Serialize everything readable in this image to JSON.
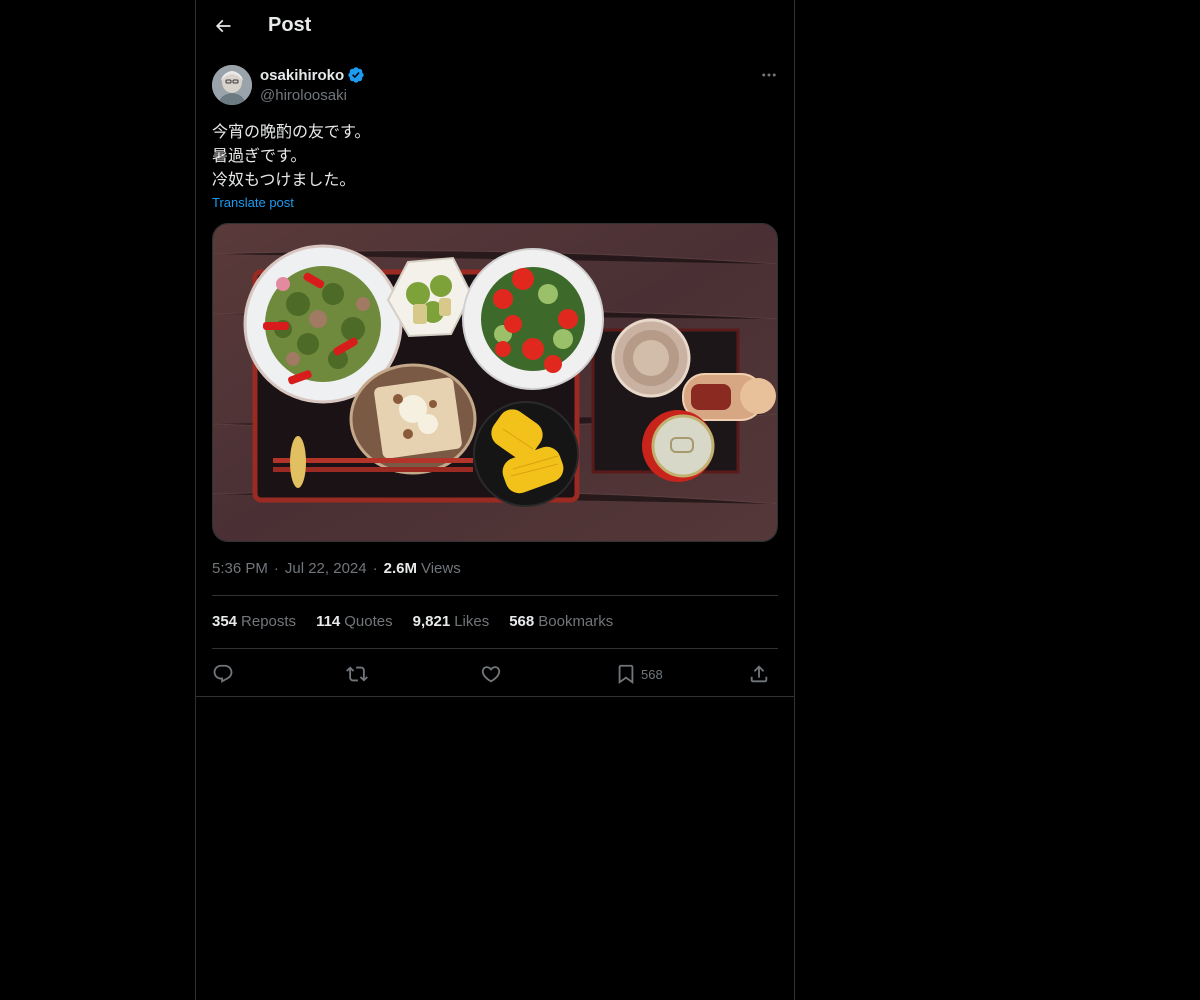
{
  "header": {
    "title": "Post",
    "back_icon": "arrow-left-icon"
  },
  "author": {
    "display_name": "osakihiroko",
    "handle": "@hiroloosaki",
    "verified": true,
    "verified_color": "#1d9bf0"
  },
  "post": {
    "lines": [
      "今宵の晩酌の友です。",
      "暑過ぎです。",
      "冷奴もつけました。"
    ],
    "translate_label": "Translate post"
  },
  "meta": {
    "time": "5:36 PM",
    "date": "Jul 22, 2024",
    "views_count": "2.6M",
    "views_label": "Views"
  },
  "stats": [
    {
      "count": "354",
      "label": "Reposts"
    },
    {
      "count": "114",
      "label": "Quotes"
    },
    {
      "count": "9,821",
      "label": "Likes"
    },
    {
      "count": "568",
      "label": "Bookmarks"
    }
  ],
  "actions": {
    "reply_icon": "reply-icon",
    "repost_icon": "repost-icon",
    "like_icon": "heart-icon",
    "bookmark_icon": "bookmark-icon",
    "bookmark_count": "568",
    "share_icon": "share-icon"
  },
  "colors": {
    "background": "#000000",
    "text": "#e7e9ea",
    "muted": "#71767b",
    "accent": "#1d9bf0",
    "border": "#2f3336"
  }
}
